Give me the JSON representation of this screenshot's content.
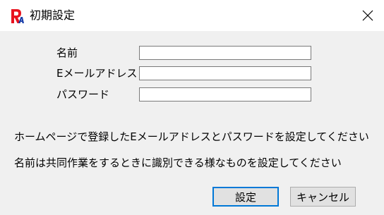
{
  "window": {
    "title": "初期設定",
    "app_icon": "ra-logo-icon",
    "close_icon": "close-icon"
  },
  "form": {
    "name_label": "名前",
    "email_label": "Eメールアドレス",
    "password_label": "パスワード",
    "name_value": "",
    "email_value": "",
    "password_value": ""
  },
  "messages": {
    "line1": "ホームページで登録したEメールアドレスとパスワードを設定してください",
    "line2": "名前は共同作業をするときに識別できる様なものを設定してください"
  },
  "buttons": {
    "ok_label": "設定",
    "cancel_label": "キャンセル"
  },
  "colors": {
    "logo_red": "#e8121e",
    "logo_blue": "#1a3faa",
    "default_button_border": "#0078d7"
  }
}
